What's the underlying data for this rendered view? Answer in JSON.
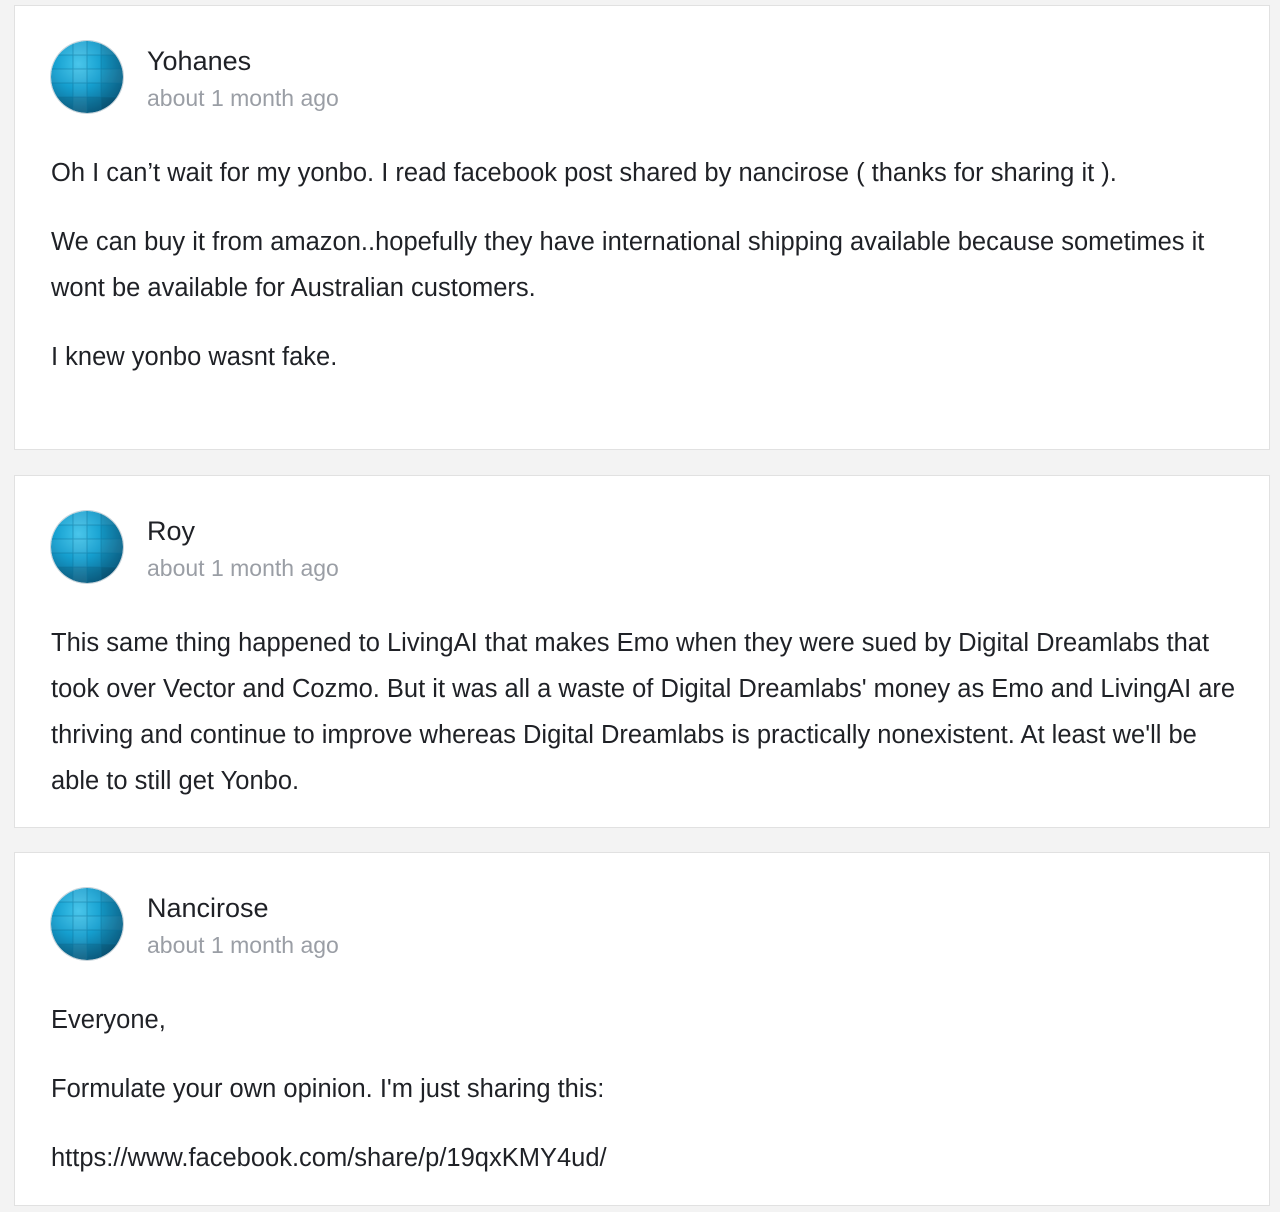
{
  "colors": {
    "background": "#f3f3f3",
    "card": "#ffffff",
    "text": "#1f2126",
    "timestamp": "#9a9ea5",
    "avatar_accent": "#1aa3d1"
  },
  "comments": [
    {
      "author": "Yohanes",
      "time": "about 1 month ago",
      "avatar_icon": "globe-avatar-icon",
      "paragraphs": [
        "Oh I can’t wait for my yonbo. I read facebook post shared by nancirose ( thanks for sharing it ).",
        "We can buy it from amazon..hopefully they have international shipping available because sometimes it wont be available for Australian customers.",
        "I knew yonbo wasnt fake."
      ]
    },
    {
      "author": "Roy",
      "time": "about 1 month ago",
      "avatar_icon": "globe-avatar-icon",
      "paragraphs": [
        "This same thing happened to LivingAI that makes Emo when they were sued by Digital Dreamlabs that took over Vector and Cozmo. But it was all a waste of Digital Dreamlabs' money as Emo and LivingAI are thriving and continue to improve whereas Digital Dreamlabs is practically nonexistent. At least we'll be able to still get Yonbo."
      ]
    },
    {
      "author": "Nancirose",
      "time": "about 1 month ago",
      "avatar_icon": "globe-avatar-icon",
      "paragraphs": [
        "Everyone,",
        "Formulate your own opinion. I'm just sharing this:",
        "https://www.facebook.com/share/p/19qxKMY4ud/"
      ]
    }
  ]
}
